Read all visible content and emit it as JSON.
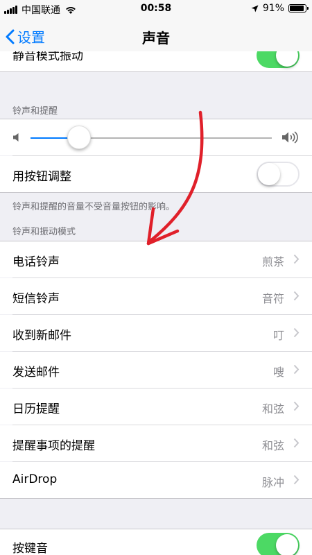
{
  "status_bar": {
    "carrier": "中国联通",
    "time": "00:58",
    "battery_percent": "91%",
    "battery_level": 0.91
  },
  "nav": {
    "back_label": "设置",
    "title": "声音"
  },
  "silent_vibrate": {
    "label": "静音模式振动",
    "on": true
  },
  "ringer_section": {
    "header": "铃声和提醒",
    "volume_level": 0.2,
    "change_with_buttons_label": "用按钮调整",
    "change_with_buttons_on": false,
    "footer": "铃声和提醒的音量不受音量按钮的影响。"
  },
  "patterns_section": {
    "header": "铃声和振动模式",
    "rows": [
      {
        "label": "电话铃声",
        "value": "煎茶"
      },
      {
        "label": "短信铃声",
        "value": "音符"
      },
      {
        "label": "收到新邮件",
        "value": "叮"
      },
      {
        "label": "发送邮件",
        "value": "嗖"
      },
      {
        "label": "日历提醒",
        "value": "和弦"
      },
      {
        "label": "提醒事项的提醒",
        "value": "和弦"
      },
      {
        "label": "AirDrop",
        "value": "脉冲"
      }
    ]
  },
  "keyboard_clicks": {
    "label": "按键音",
    "on": true
  },
  "colors": {
    "accent": "#007aff",
    "toggle_on": "#4cd964",
    "annotation": "#e0202a"
  }
}
